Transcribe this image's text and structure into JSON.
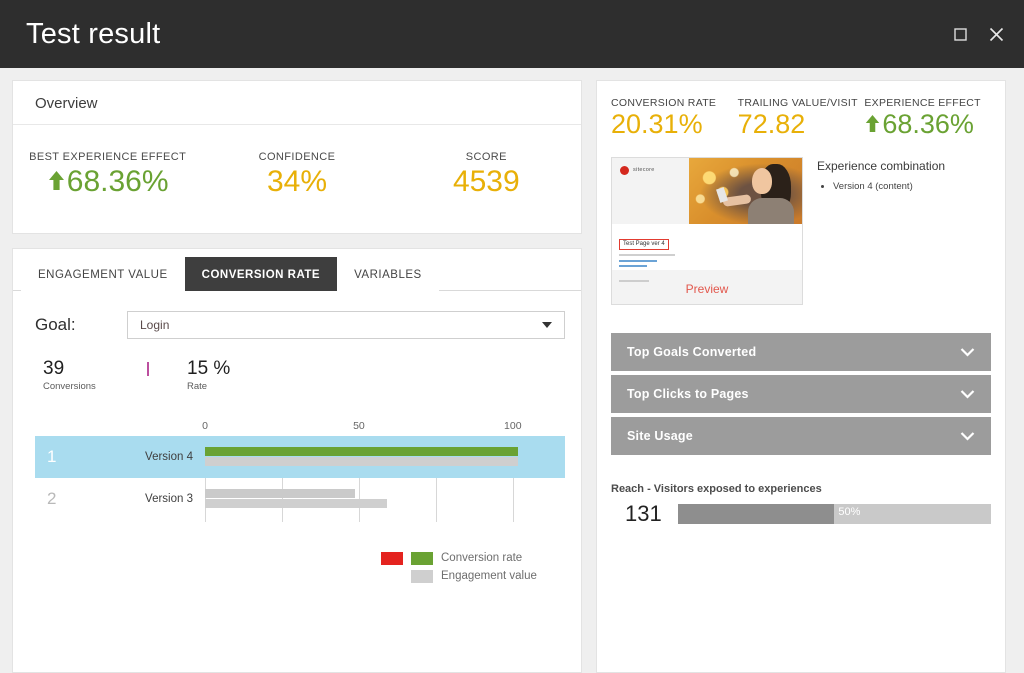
{
  "window": {
    "title": "Test result",
    "maximize_icon": "maximize-icon",
    "close_icon": "close-icon"
  },
  "overview": {
    "heading": "Overview",
    "stats": [
      {
        "label": "BEST EXPERIENCE EFFECT",
        "value": "68.36%",
        "arrow": "up",
        "color": "#6aa233"
      },
      {
        "label": "CONFIDENCE",
        "value": "34%",
        "arrow": "",
        "color": "#e8b008"
      },
      {
        "label": "SCORE",
        "value": "4539",
        "arrow": "",
        "color": "#e8b008"
      }
    ]
  },
  "tabs": [
    {
      "label": "ENGAGEMENT VALUE",
      "active": false
    },
    {
      "label": "CONVERSION RATE",
      "active": true
    },
    {
      "label": "VARIABLES",
      "active": false
    }
  ],
  "goal": {
    "label": "Goal:",
    "selected": "Login",
    "options": [
      "Login"
    ]
  },
  "kpis": [
    {
      "value": "39",
      "caption": "Conversions"
    },
    {
      "value": "15 %",
      "caption": "Rate"
    }
  ],
  "chart_data": {
    "type": "bar",
    "title": "",
    "orientation": "horizontal",
    "xlabel": "",
    "ylabel": "",
    "xlim": [
      0,
      115
    ],
    "ticks": [
      0,
      50,
      100
    ],
    "gridlines": [
      0,
      25,
      50,
      75,
      100
    ],
    "grid": true,
    "categories": [
      "Version 4",
      "Version 3"
    ],
    "ranks": [
      "1",
      "2"
    ],
    "highlighted_row": 0,
    "series": [
      {
        "name": "Conversion rate",
        "values": [
          100,
          48
        ],
        "colors": [
          "#6aa233",
          "#cacaca"
        ]
      },
      {
        "name": "Engagement value",
        "values": [
          100,
          58
        ],
        "colors": [
          "#cfcfcf",
          "#cfcfcf"
        ]
      }
    ],
    "legend": [
      {
        "label": "Conversion rate",
        "swatches": [
          "#e4231f",
          "#6aa233"
        ]
      },
      {
        "label": "Engagement value",
        "swatches": [
          "",
          "#cfcfcf"
        ]
      }
    ],
    "legend_position": "bottom-right"
  },
  "right_panel": {
    "stats": [
      {
        "label": "CONVERSION RATE",
        "value": "20.31%",
        "arrow": "",
        "color": "#e8b008"
      },
      {
        "label": "TRAILING VALUE/VISIT",
        "value": "72.82",
        "arrow": "",
        "color": "#e8b008"
      },
      {
        "label": "EXPERIENCE EFFECT",
        "value": "68.36%",
        "arrow": "up",
        "color": "#6aa233"
      }
    ],
    "preview": {
      "brand": "sitecore",
      "page_heading": "Test Page ver 4",
      "overlay_label": "Preview"
    },
    "combination": {
      "title": "Experience combination",
      "items": [
        "Version 4 (content)"
      ]
    },
    "accordions": [
      {
        "label": "Top Goals Converted"
      },
      {
        "label": "Top Clicks to Pages"
      },
      {
        "label": "Site Usage"
      }
    ],
    "reach": {
      "title": "Reach - Visitors exposed to experiences",
      "value": "131",
      "percent_label": "50%",
      "percent": 50
    }
  }
}
